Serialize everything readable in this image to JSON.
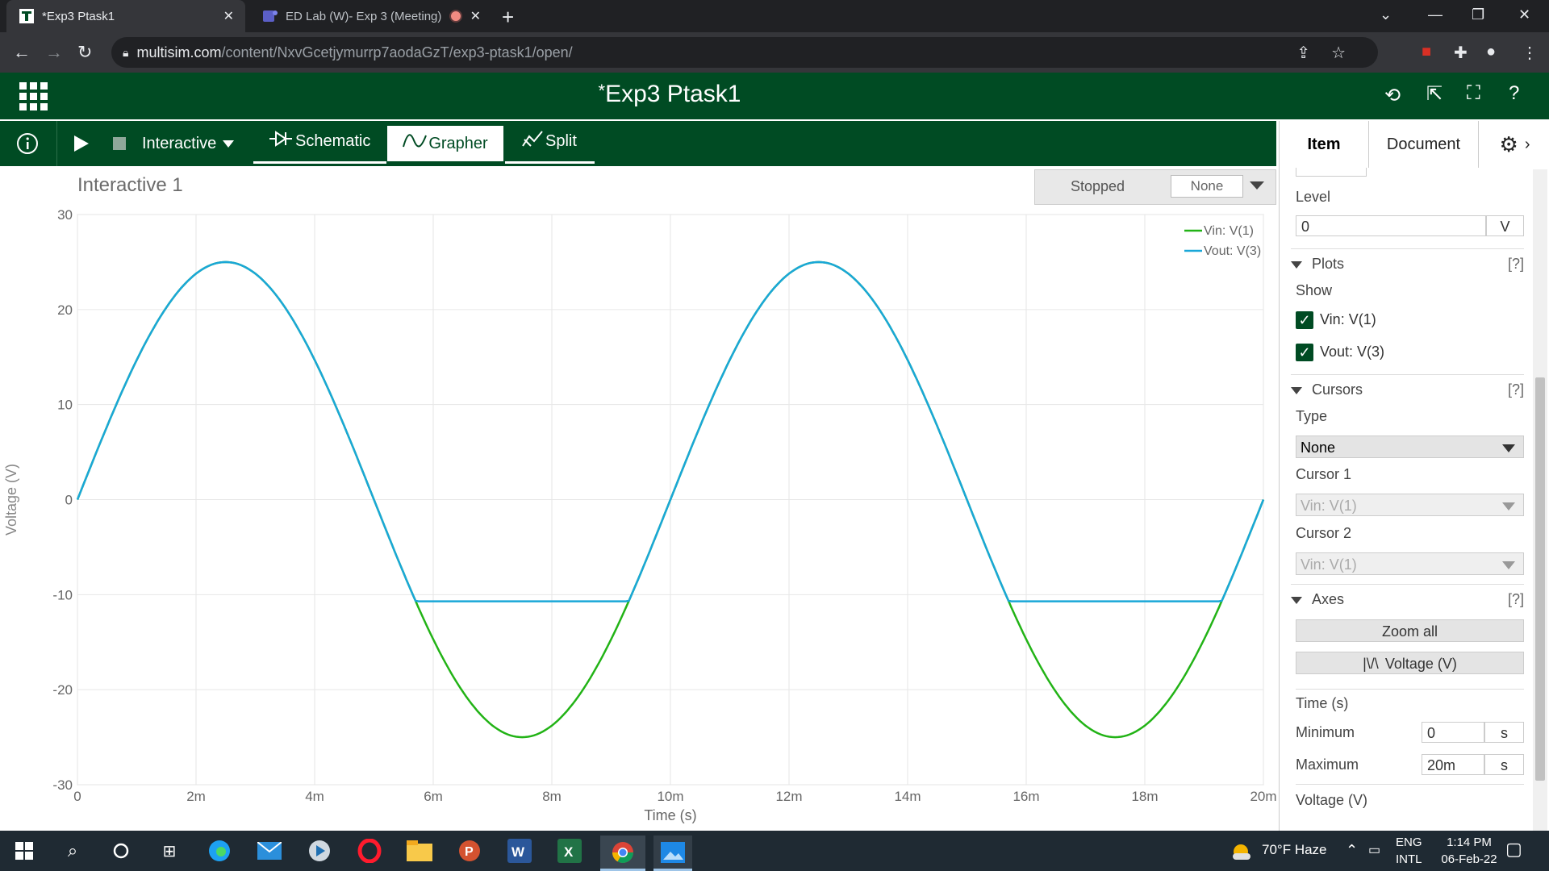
{
  "browser": {
    "tabs": [
      {
        "title": "*Exp3 Ptask1",
        "active": true
      },
      {
        "title": "ED Lab (W)- Exp 3 (Meeting)",
        "active": false
      }
    ],
    "url_host": "multisim.com",
    "url_path": "/content/NxvGcetjymurrp7aodaGzT/exp3-ptask1/open/"
  },
  "app": {
    "title": "Exp3 Ptask1",
    "title_prefix": "*",
    "toolbar": {
      "mode": "Interactive",
      "schematic": "Schematic",
      "grapher": "Grapher",
      "split": "Split"
    }
  },
  "graph": {
    "title": "Interactive 1",
    "status": "Stopped",
    "status_option": "None"
  },
  "chart_data": {
    "type": "line",
    "xlabel": "Time (s)",
    "ylabel": "Voltage (V)",
    "xlim": [
      0,
      0.02
    ],
    "ylim": [
      -30,
      30
    ],
    "x_ticks": [
      "0",
      "2m",
      "4m",
      "6m",
      "8m",
      "10m",
      "12m",
      "14m",
      "16m",
      "18m",
      "20m"
    ],
    "y_ticks": [
      "30",
      "20",
      "10",
      "0",
      "-10",
      "-20",
      "-30"
    ],
    "grid": true,
    "legend_position": "top-right",
    "series": [
      {
        "name": "Vin: V(1)",
        "color": "#22b316",
        "kind": "sine",
        "amplitude": 25,
        "frequency_hz": 100
      },
      {
        "name": "Vout: V(3)",
        "color": "#1aa7d8",
        "kind": "clipped-sine",
        "amplitude": 25,
        "frequency_hz": 100,
        "clip_min": -10.7
      }
    ]
  },
  "panel": {
    "tabs": {
      "item": "Item",
      "document": "Document"
    },
    "level_label": "Level",
    "level_value": "0",
    "level_unit": "V",
    "plots": {
      "title": "Plots",
      "help": "[?]",
      "show_label": "Show",
      "items": [
        "Vin: V(1)",
        "Vout: V(3)"
      ]
    },
    "cursors": {
      "title": "Cursors",
      "help": "[?]",
      "type_label": "Type",
      "type_value": "None",
      "cursor1_label": "Cursor 1",
      "cursor1_value": "Vin: V(1)",
      "cursor2_label": "Cursor 2",
      "cursor2_value": "Vin: V(1)"
    },
    "axes": {
      "title": "Axes",
      "help": "[?]",
      "zoom_all": "Zoom all",
      "voltage_btn": "Voltage (V)",
      "time_label": "Time (s)",
      "min_label": "Minimum",
      "min_value": "0",
      "max_label": "Maximum",
      "max_value": "20m",
      "unit": "s",
      "voltage_label": "Voltage (V)"
    }
  },
  "taskbar": {
    "weather": "70°F  Haze",
    "lang1": "ENG",
    "lang2": "INTL",
    "time": "1:14 PM",
    "date": "06-Feb-22"
  }
}
